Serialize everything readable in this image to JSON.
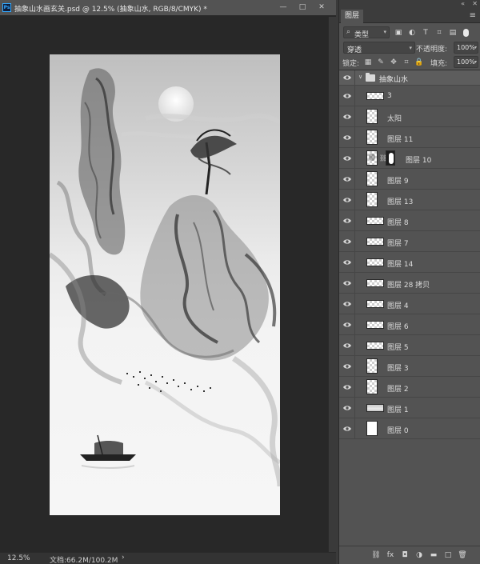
{
  "document": {
    "title": "抽象山水画玄关.psd @ 12.5% (抽象山水, RGB/8/CMYK) *",
    "app_badge": "Ps",
    "zoom": "12.5%",
    "doc_size": "文档:66.2M/100.2M",
    "status_arrow": "›",
    "window_buttons": {
      "minimize": "—",
      "maximize": "□",
      "close": "✕"
    }
  },
  "layers_panel": {
    "tab": "图层",
    "menu_icon": "≡",
    "collapse_icon": "«",
    "close_icon": "✕",
    "filter_kind": "类型",
    "filter_icons": [
      "image-filter-icon",
      "adjustment-filter-icon",
      "type-filter-icon",
      "shape-filter-icon",
      "smart-object-filter-icon"
    ],
    "filter_glyphs": [
      "▣",
      "◐",
      "T",
      "⌗",
      "▤"
    ],
    "blend_mode": "穿透",
    "opacity_label": "不透明度:",
    "opacity": "100%",
    "lock_label": "锁定:",
    "lock_glyphs": [
      "▦",
      "✎",
      "✥",
      "⌗",
      "🔒"
    ],
    "fill_label": "填充:",
    "fill": "100%",
    "group": {
      "name": "抽象山水",
      "expanded": true
    },
    "layers": [
      {
        "name": "3",
        "thumb": "wide"
      },
      {
        "name": "太阳",
        "thumb": "tall"
      },
      {
        "name": "图层 11",
        "thumb": "tall"
      },
      {
        "name": "图层 10",
        "thumb": "tall-ink",
        "mask": true
      },
      {
        "name": "图层 9",
        "thumb": "tall"
      },
      {
        "name": "图层 13",
        "thumb": "tall"
      },
      {
        "name": "图层 8",
        "thumb": "wide"
      },
      {
        "name": "图层 7",
        "thumb": "wide"
      },
      {
        "name": "图层 14",
        "thumb": "wide"
      },
      {
        "name": "图层 28 拷贝",
        "thumb": "wide"
      },
      {
        "name": "图层 4",
        "thumb": "wide"
      },
      {
        "name": "图层 6",
        "thumb": "wide"
      },
      {
        "name": "图层 5",
        "thumb": "wide"
      },
      {
        "name": "图层 3",
        "thumb": "tall"
      },
      {
        "name": "图层 2",
        "thumb": "tall"
      },
      {
        "name": "图层 1",
        "thumb": "wide-gray"
      },
      {
        "name": "图层 0",
        "thumb": "white"
      }
    ],
    "footer_glyphs": [
      "⛓",
      "fx",
      "◘",
      "◑",
      "▬",
      "□",
      "🗑"
    ]
  }
}
